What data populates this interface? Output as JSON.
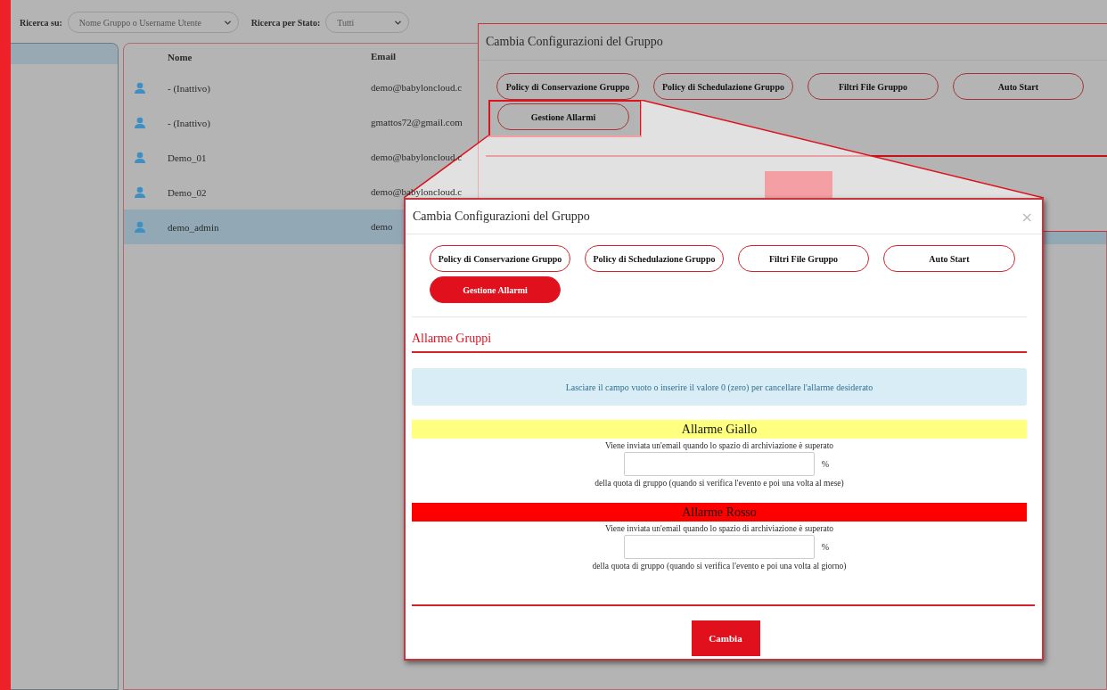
{
  "filters": [
    {
      "label": "Ricerca su:",
      "value": "Nome Gruppo o Username Utente"
    },
    {
      "label": "Ricerca per Stato:",
      "value": "Tutti"
    }
  ],
  "table": {
    "columns": [
      "Nome",
      "Email"
    ],
    "rows": [
      {
        "name": "- (Inattivo)",
        "email": "demo@babyloncloud.c",
        "selected": false
      },
      {
        "name": "- (Inattivo)",
        "email": "gmattos72@gmail.com",
        "selected": false
      },
      {
        "name": "Demo_01",
        "email": "demo@babyloncloud.c",
        "selected": false
      },
      {
        "name": "Demo_02",
        "email": "demo@babyloncloud.c",
        "selected": false
      },
      {
        "name": "demo_admin",
        "email": "demo",
        "selected": true
      }
    ]
  },
  "background_dialog": {
    "title": "Cambia Configurazioni del Gruppo",
    "tabs": [
      {
        "label": "Policy di Conservazione Gruppo",
        "selected": false,
        "highlighted": false
      },
      {
        "label": "Policy di Schedulazione Gruppo",
        "selected": false,
        "highlighted": false
      },
      {
        "label": "Filtri File Gruppo",
        "selected": false,
        "highlighted": false
      },
      {
        "label": "Auto Start",
        "selected": false,
        "highlighted": false
      },
      {
        "label": "Gestione Allarmi",
        "selected": false,
        "highlighted": true
      }
    ]
  },
  "dialog": {
    "title": "Cambia Configurazioni del Gruppo",
    "close": "×",
    "tabs": [
      {
        "label": "Policy di Conservazione Gruppo",
        "selected": false
      },
      {
        "label": "Policy di Schedulazione Gruppo",
        "selected": false
      },
      {
        "label": "Filtri File Gruppo",
        "selected": false
      },
      {
        "label": "Auto Start",
        "selected": false
      },
      {
        "label": "Gestione Allarmi",
        "selected": true
      }
    ],
    "section_title": "Allarme Gruppi",
    "info": "Lasciare il campo vuoto o inserire il valore 0 (zero) per cancellare l'allarme desiderato",
    "alarms": [
      {
        "title": "Allarme Giallo",
        "color": "#ffff80",
        "description": "Viene inviata un'email quando lo spazio di archiviazione è superato",
        "unit": "%",
        "note": "della quota di gruppo (quando si verifica l'evento e poi una volta al mese)"
      },
      {
        "title": "Allarme Rosso",
        "color": "#ff0000",
        "description": "Viene inviata un'email quando lo spazio di archiviazione è superato",
        "unit": "%",
        "note": "della quota di gruppo (quando si verifica l'evento e poi una volta al giorno)"
      }
    ],
    "submit": "Cambia"
  }
}
